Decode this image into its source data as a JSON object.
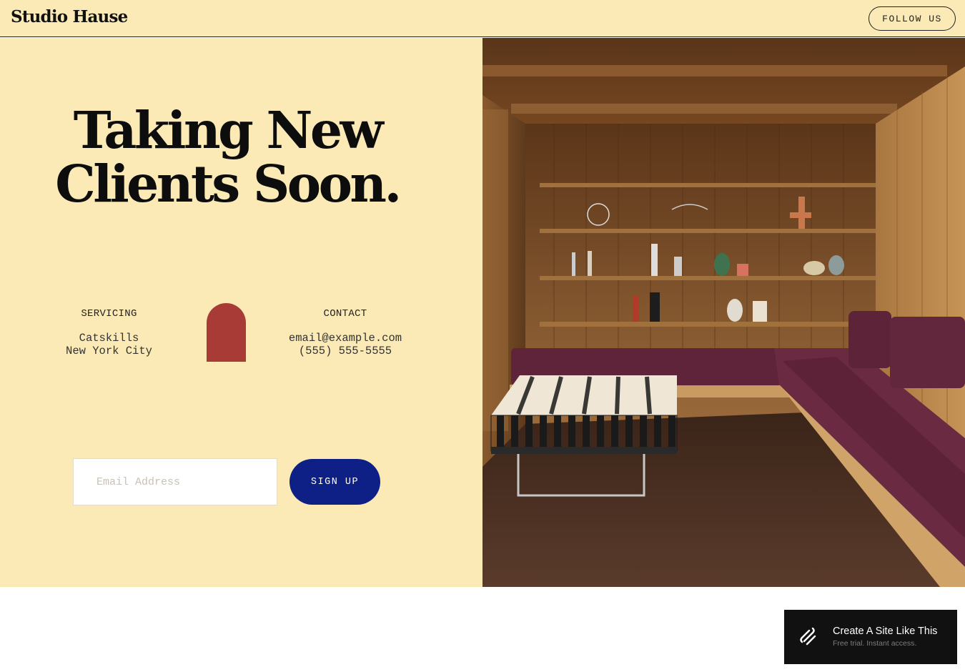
{
  "header": {
    "logo": "Studio Hause",
    "follow_label": "FOLLOW US"
  },
  "hero": {
    "headline_line1": "Taking New",
    "headline_line2": "Clients Soon."
  },
  "servicing": {
    "label": "SERVICING",
    "lines": [
      "Catskills",
      "New York City"
    ]
  },
  "contact": {
    "label": "CONTACT",
    "email": "email@example.com",
    "phone": "(555) 555-5555"
  },
  "signup": {
    "placeholder": "Email Address",
    "button_label": "SIGN UP"
  },
  "badge": {
    "title": "Create A Site Like This",
    "subtitle": "Free trial. Instant access."
  },
  "colors": {
    "background": "#fbeab5",
    "accent_button": "#0e1f86",
    "arch": "#a83b36",
    "badge": "#111111"
  },
  "icons": {
    "badge_logo": "squarespace-logo-icon",
    "arch": "arch-shape"
  }
}
